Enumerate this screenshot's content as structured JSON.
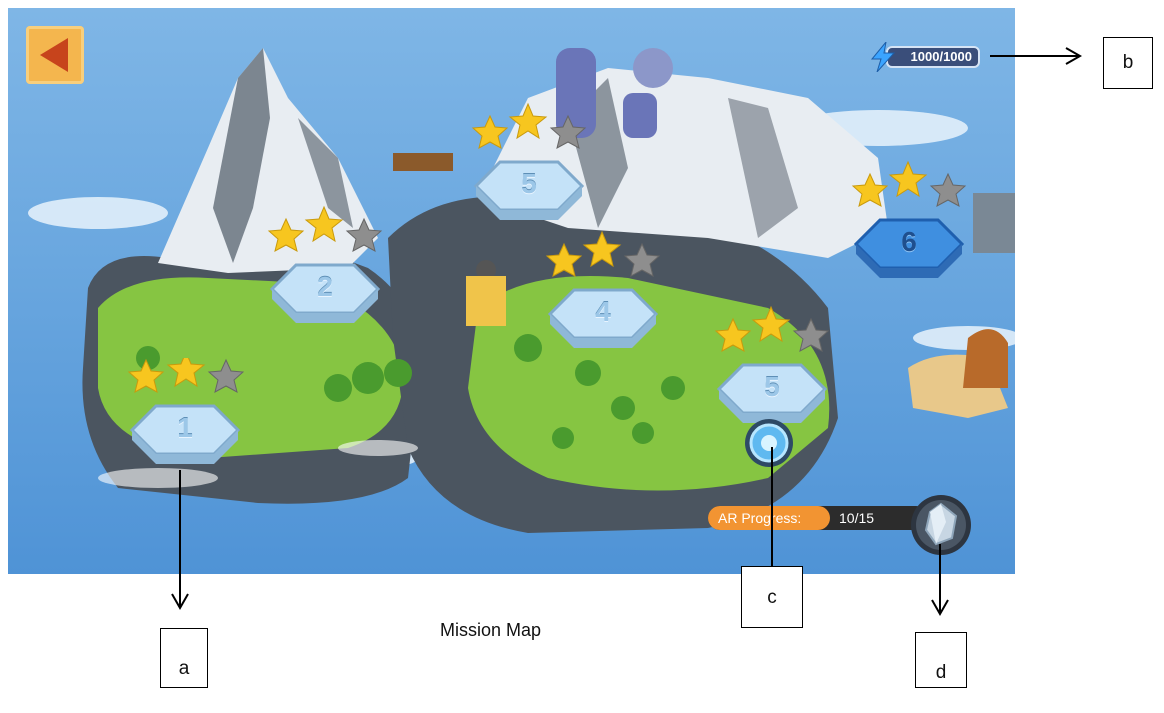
{
  "hud": {
    "energy_text": "1000/1000",
    "ar_label": "AR Progress:",
    "ar_value": "10/15"
  },
  "levels": [
    {
      "number": "1",
      "stars": 2
    },
    {
      "number": "2",
      "stars": 2
    },
    {
      "number": "4",
      "stars": 2
    },
    {
      "number": "5",
      "stars": 2
    },
    {
      "number": "5",
      "stars": 2
    },
    {
      "number": "6",
      "stars": 2
    }
  ],
  "caption": "Mission Map",
  "callouts": {
    "a": "a",
    "b": "b",
    "c": "c",
    "d": "d"
  },
  "colors": {
    "star_filled": "#f7c61f",
    "star_empty": "#8e8e8e",
    "accent_orange": "#f29432",
    "ocean": "#5b9de0",
    "grass": "#86c542"
  },
  "icons": {
    "back": "back-arrow-icon",
    "energy": "lightning-icon",
    "portal": "portal-icon",
    "crystal": "crystal-icon"
  }
}
